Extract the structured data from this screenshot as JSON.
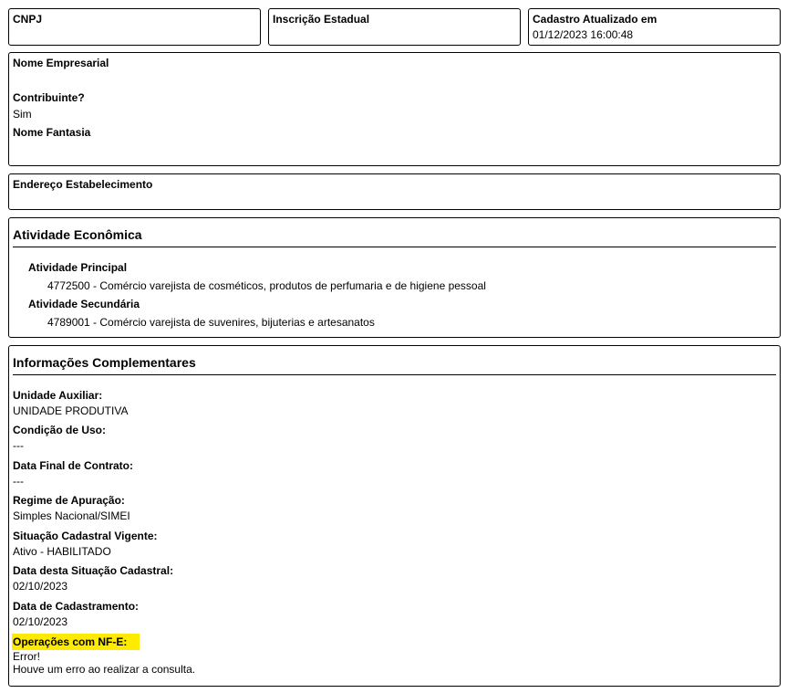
{
  "header": {
    "cnpj": {
      "label": "CNPJ",
      "value": ""
    },
    "ie": {
      "label": "Inscrição Estadual",
      "value": ""
    },
    "updated": {
      "label": "Cadastro Atualizado em",
      "value": "01/12/2023 16:00:48"
    }
  },
  "company": {
    "name_label": "Nome Empresarial",
    "name_value": "",
    "taxpayer_label": "Contribuinte?",
    "taxpayer_value": "Sim",
    "fantasy_label": "Nome Fantasia",
    "fantasy_value": ""
  },
  "address": {
    "label": "Endereço Estabelecimento",
    "value": ""
  },
  "activity": {
    "title": "Atividade Econômica",
    "main_label": "Atividade Principal",
    "main_value": "4772500 - Comércio varejista de cosméticos, produtos de perfumaria e de higiene pessoal",
    "secondary_label": "Atividade Secundária",
    "secondary_value": "4789001 - Comércio varejista de suvenires, bijuterias e artesanatos"
  },
  "complementary": {
    "title": "Informações Complementares",
    "fields": [
      {
        "label": "Unidade Auxiliar:",
        "value": "UNIDADE PRODUTIVA"
      },
      {
        "label": "Condição de Uso:",
        "value": "---"
      },
      {
        "label": "Data Final de Contrato:",
        "value": "---"
      },
      {
        "label": "Regime de Apuração:",
        "value": "Simples Nacional/SIMEI"
      },
      {
        "label": "Situação Cadastral Vigente:",
        "value": "Ativo - HABILITADO"
      },
      {
        "label": "Data desta Situação Cadastral:",
        "value": "02/10/2023"
      },
      {
        "label": "Data de Cadastramento:",
        "value": "02/10/2023"
      }
    ],
    "nfe_label": "Operações com NF-E:",
    "nfe_error": "Error!",
    "nfe_message": "Houve um erro ao realizar a consulta.",
    "highlight_color": "#ffeb00"
  }
}
